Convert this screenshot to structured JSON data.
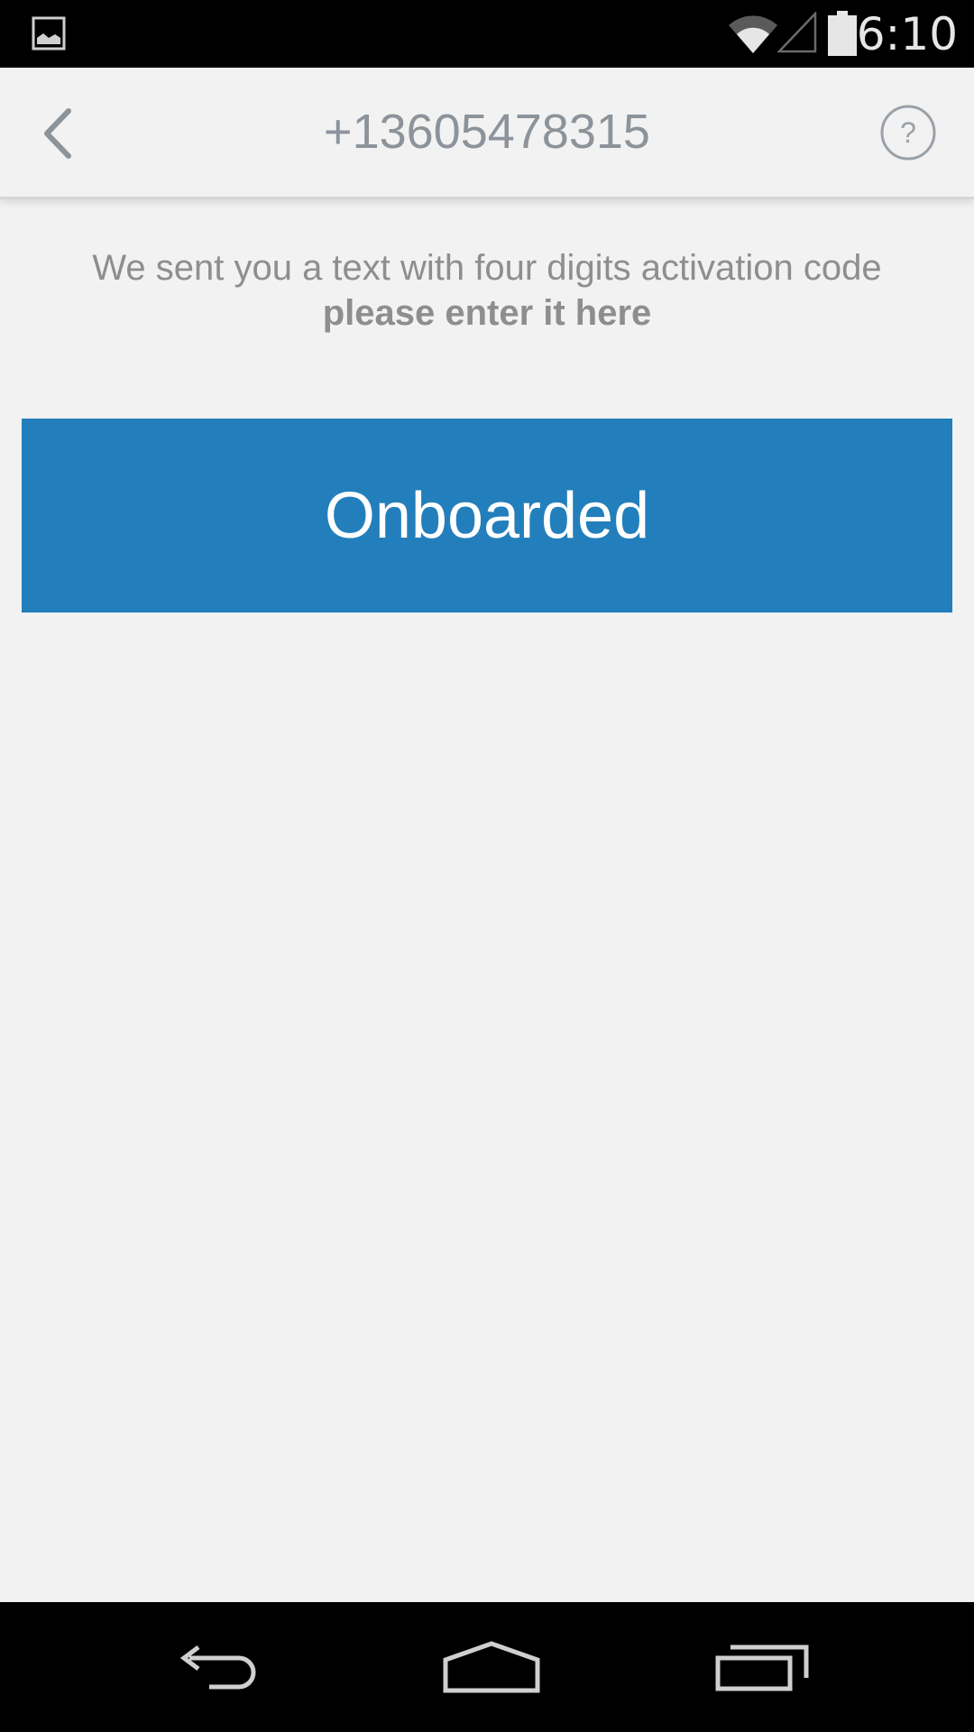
{
  "status_bar": {
    "time": "6:10",
    "icons": [
      "gallery-icon",
      "wifi-icon",
      "cell-signal-icon",
      "battery-icon"
    ]
  },
  "header": {
    "title": "+13605478315",
    "back_icon": "chevron-left-icon",
    "help_icon": "question-circle-icon"
  },
  "content": {
    "message_line1": "We sent you a text with four digits activation code",
    "message_line2": "please enter it here",
    "button_label": "Onboarded"
  },
  "nav_bar": {
    "icons": [
      "back-icon",
      "home-icon",
      "recents-icon"
    ]
  },
  "colors": {
    "background": "#f2f2f2",
    "accent": "#237fbb",
    "title_text": "#8c939a",
    "message_text": "#8e8e8e"
  }
}
